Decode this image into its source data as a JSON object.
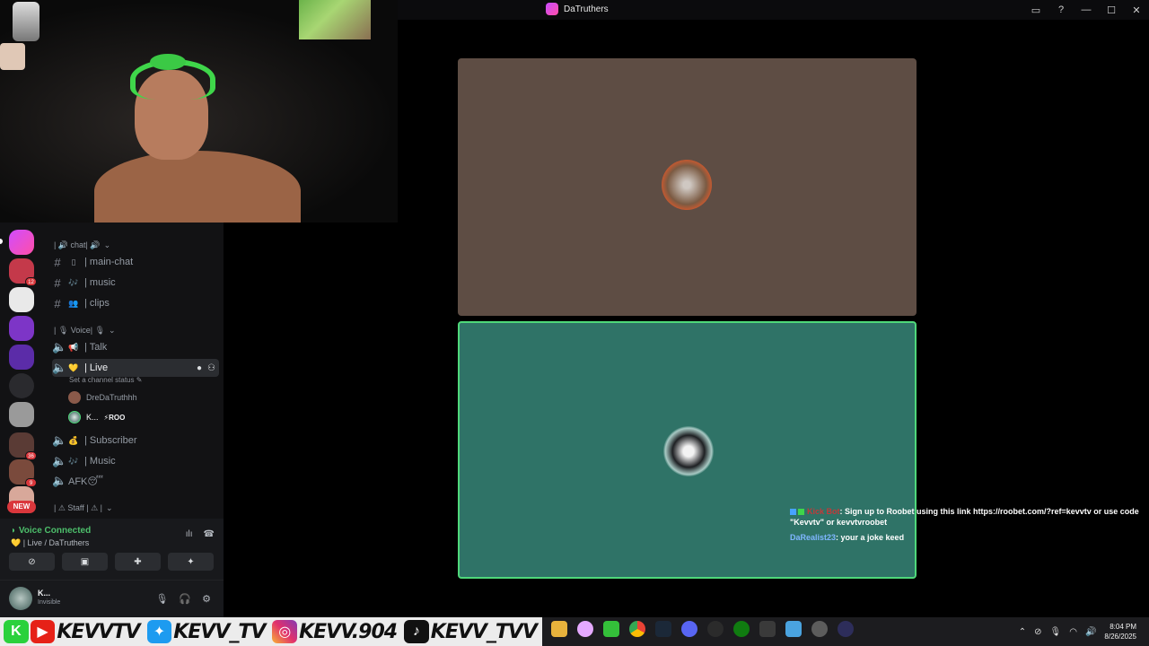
{
  "window": {
    "title": "DaTruthers"
  },
  "sidebar": {
    "new_label": "NEW",
    "server_badges": [
      "12",
      "36",
      "9"
    ],
    "categories": {
      "chat": "| 🔊 chat| 🔊",
      "voice": "| 🎙 Voice| 🎙",
      "staff": "| ⚠ Staff | ⚠ |"
    },
    "channels": [
      {
        "icon": "#",
        "emoji": "▯",
        "label": "| main-chat"
      },
      {
        "icon": "#",
        "emoji": "🎶",
        "label": "| music"
      },
      {
        "icon": "#",
        "emoji": "👥",
        "label": "| clips"
      }
    ],
    "voice_channels": [
      {
        "emoji": "📢",
        "label": "| Talk"
      },
      {
        "emoji": "💛",
        "label": "| Live"
      },
      {
        "emoji": "💰",
        "label": "| Subscriber"
      },
      {
        "emoji": "🎶",
        "label": "| Music"
      },
      {
        "emoji": "",
        "label": "AFK😴"
      }
    ],
    "live_status": "Set a channel status",
    "voice_users": [
      {
        "name": "DreDaTruthhh"
      },
      {
        "name": "K...",
        "tag": "⚡ROO"
      }
    ]
  },
  "voice_panel": {
    "title": "Voice Connected",
    "subtitle": "💛 | Live / DaTruthers"
  },
  "user": {
    "name": "K...",
    "status": "Invisible"
  },
  "chat_overlay": {
    "messages": [
      {
        "user": "Kick Bot",
        "text": ": Sign up to Roobet using this link https://roobet.com/?ref=kevvtv or use code \"Kevvtv\" or kevvtvroobet"
      },
      {
        "user": "DaRealist23",
        "text": ": your a joke keed"
      }
    ]
  },
  "social_bar": {
    "handles": [
      "KEVVTV",
      "KEVV_TV",
      "KEVV.904",
      "KEVV_TVV"
    ]
  },
  "taskbar": {
    "time": "8:04 PM",
    "date": "8/26/2025"
  },
  "colors": {
    "tile_top": "#5e4d44",
    "tile_bottom": "#2f7367",
    "speaking_border": "#4fd87a",
    "voice_connected": "#4dbf6b"
  }
}
